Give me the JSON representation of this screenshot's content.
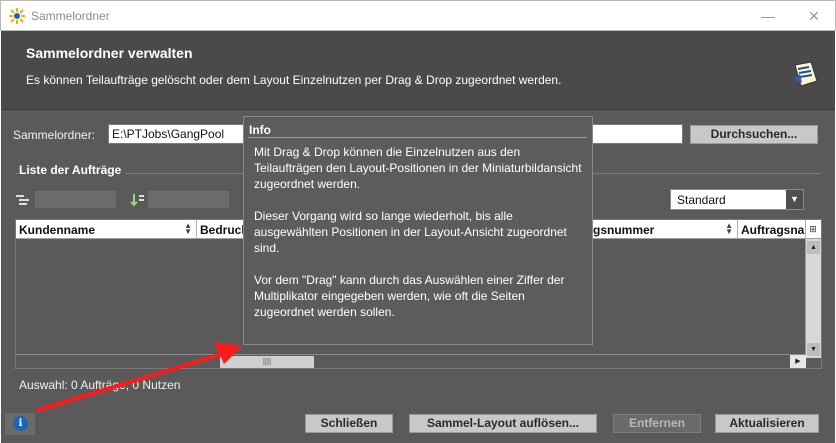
{
  "window": {
    "title": "Sammelordner",
    "minimize": "—",
    "close": "✕"
  },
  "header": {
    "title": "Sammelordner verwalten",
    "description": "Es können Teilaufträge gelöscht oder dem Layout Einzelnutzen per Drag & Drop zugeordnet werden."
  },
  "folder": {
    "label": "Sammelordner:",
    "value": "E:\\PTJobs\\GangPool",
    "browse_button": "Durchsuchen..."
  },
  "list": {
    "group_title": "Liste der Aufträge",
    "view_select": "Standard",
    "columns": [
      "Kundenname",
      "Bedruck",
      "gsnummer",
      "Auftragsnar"
    ]
  },
  "status": {
    "text": "Auswahl:  0 Aufträge, 0 Nutzen"
  },
  "buttons": {
    "close": "Schließen",
    "dissolve": "Sammel-Layout auflösen...",
    "remove": "Entfernen",
    "refresh": "Aktualisieren"
  },
  "tooltip": {
    "title": "Info",
    "p1": "Mit Drag & Drop können die Einzelnutzen aus den Teilaufträgen den Layout-Positionen in der Miniaturbildansicht zugeordnet werden.",
    "p2": "Dieser Vorgang wird so lange wiederholt, bis alle ausgewählten Positionen in der Layout-Ansicht zugeordnet sind.",
    "p3": "Vor dem \"Drag\" kann durch das Auswählen einer Ziffer der Multiplikator eingegeben werden, wie oft die Seiten zugeordnet werden sollen."
  },
  "icons": {
    "app": "app-icon",
    "header": "collect-folder-icon",
    "info": "info-icon"
  },
  "colors": {
    "dialog_bg": "#5a5a5a",
    "header_bg": "#4a4a4a",
    "arrow": "#ff1a1a",
    "info_blue": "#1c66b5"
  }
}
